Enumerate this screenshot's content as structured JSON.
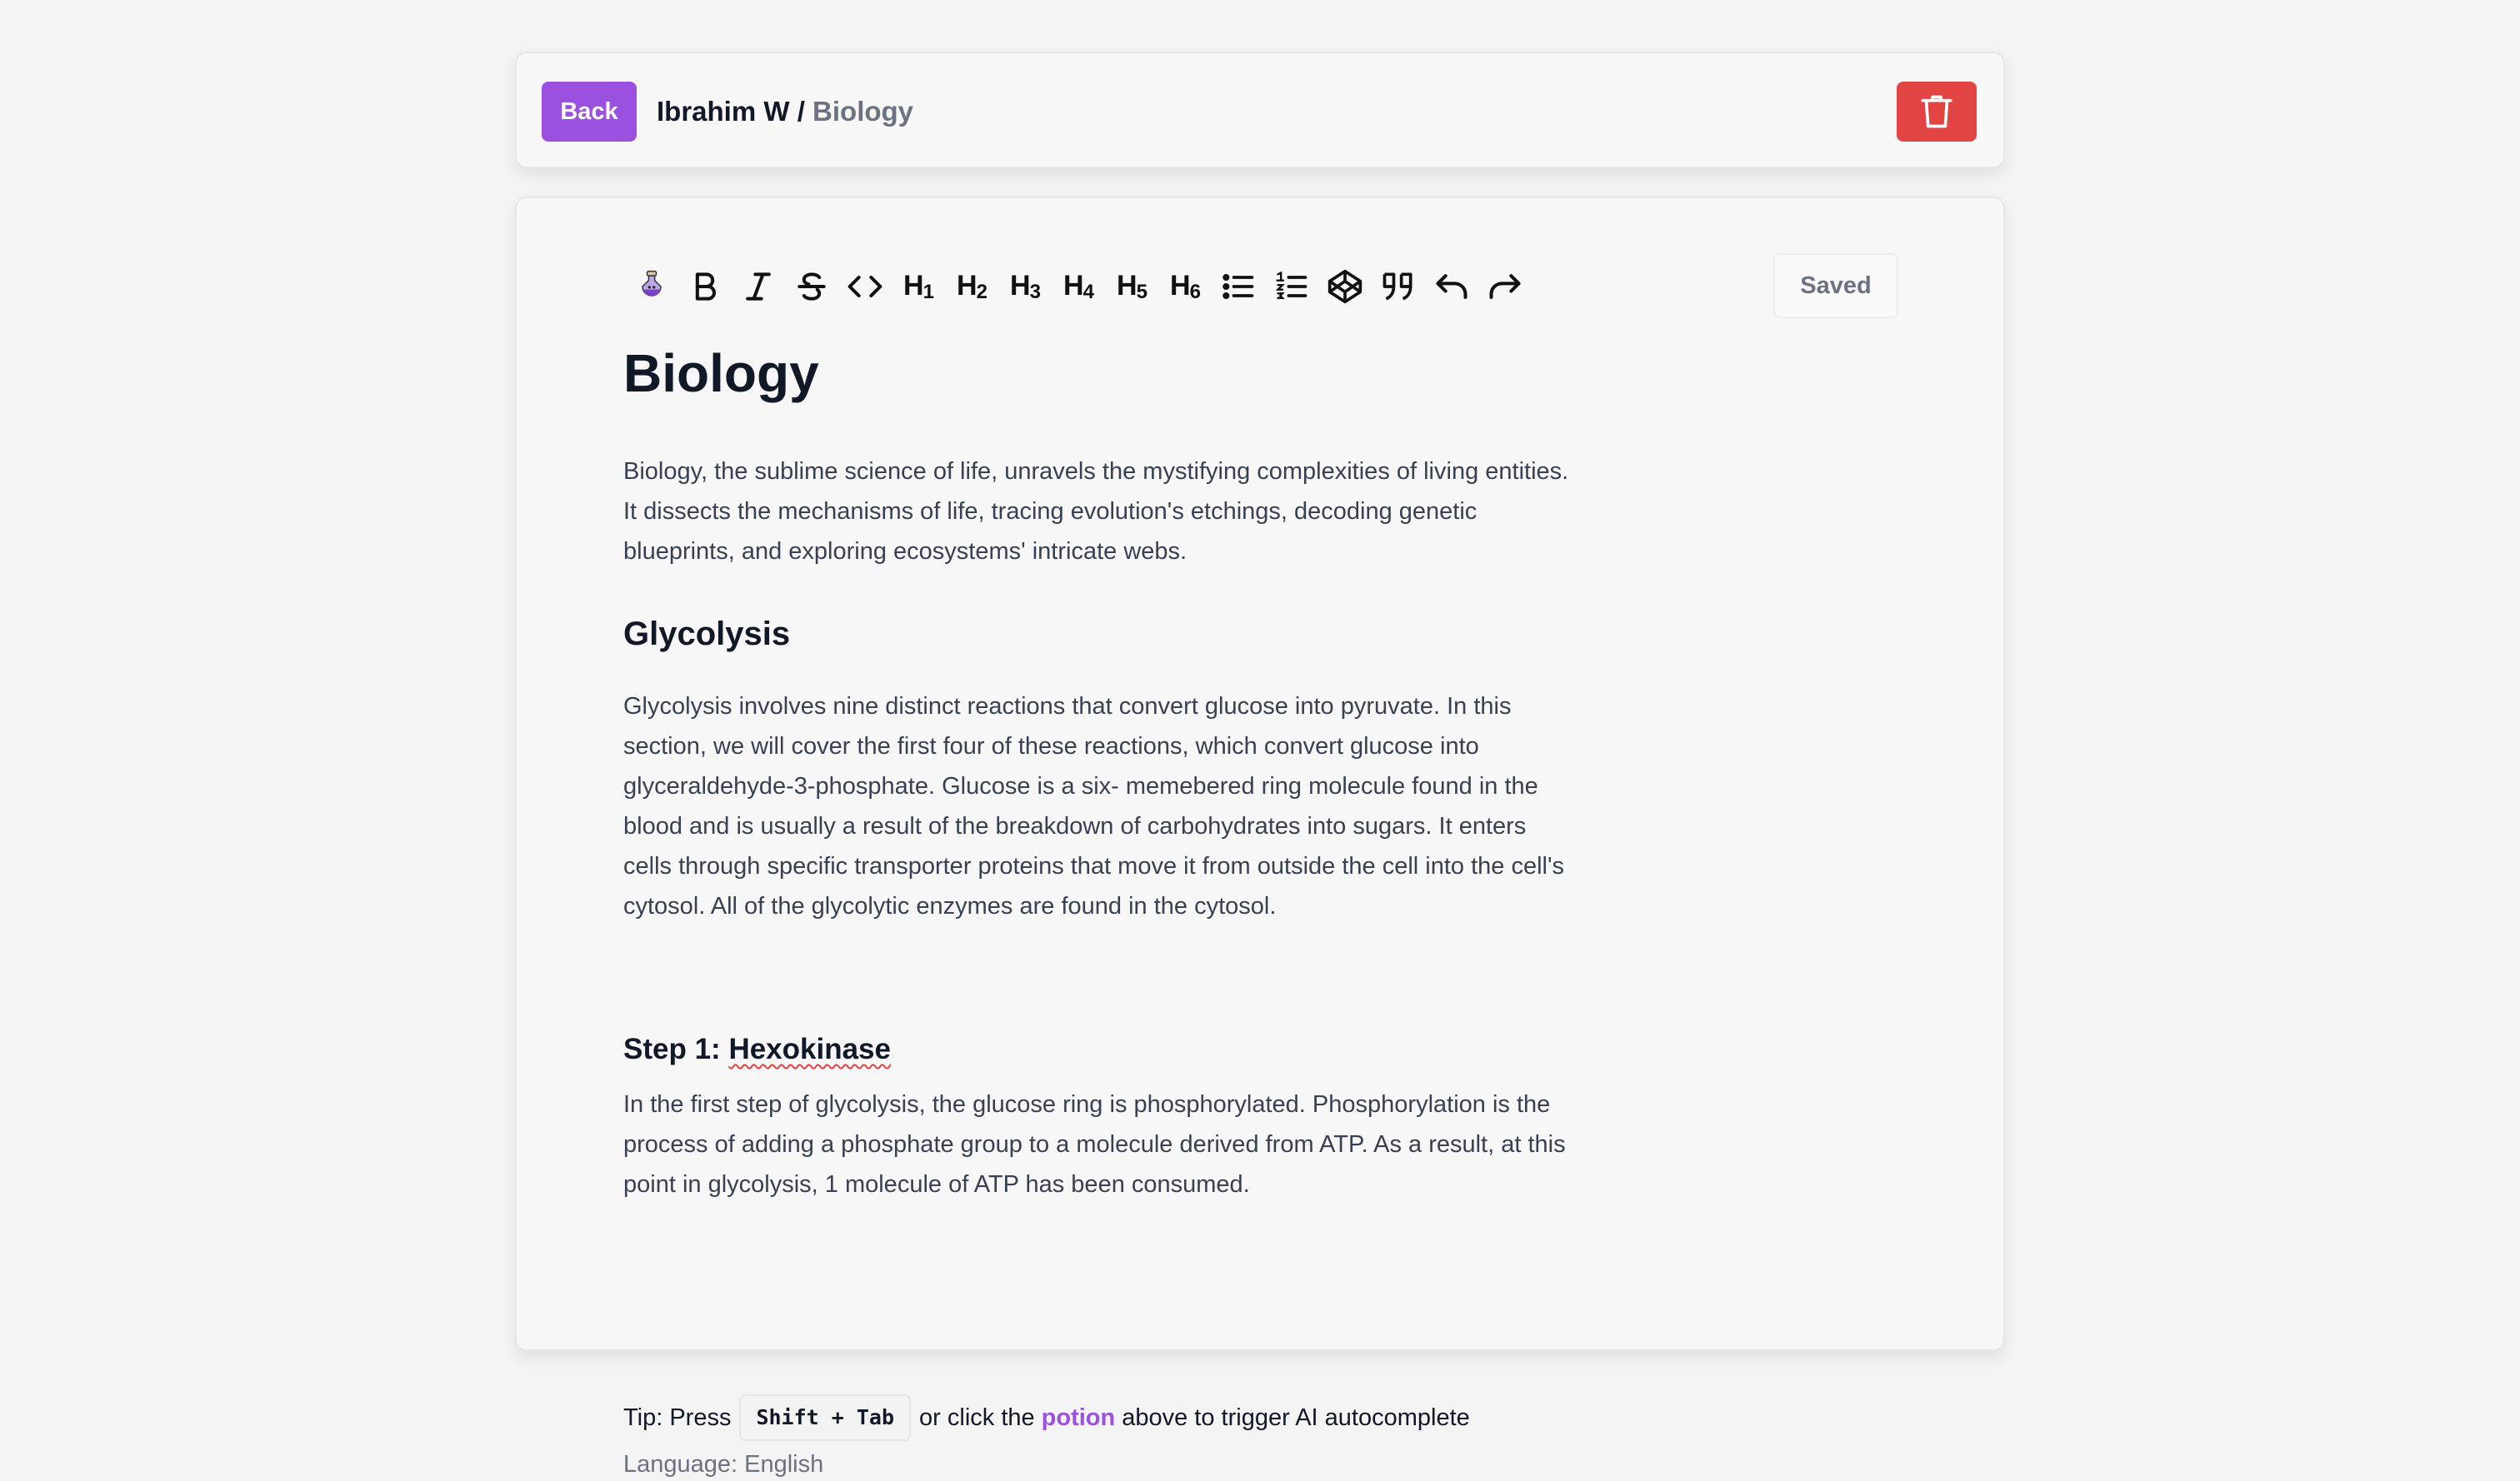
{
  "header": {
    "back_label": "Back",
    "user": "Ibrahim W",
    "separator": "/",
    "page": "Biology",
    "delete_icon": "trash-icon",
    "delete_color": "#e24444",
    "accent": "#9b51e0"
  },
  "toolbar": {
    "items": [
      {
        "name": "potion-icon"
      },
      {
        "name": "bold-icon"
      },
      {
        "name": "italic-icon"
      },
      {
        "name": "strikethrough-icon"
      },
      {
        "name": "code-icon"
      },
      {
        "name": "h1-icon",
        "label": "H",
        "num": "1"
      },
      {
        "name": "h2-icon",
        "label": "H",
        "num": "2"
      },
      {
        "name": "h3-icon",
        "label": "H",
        "num": "3"
      },
      {
        "name": "h4-icon",
        "label": "H",
        "num": "4"
      },
      {
        "name": "h5-icon",
        "label": "H",
        "num": "5"
      },
      {
        "name": "h6-icon",
        "label": "H",
        "num": "6"
      },
      {
        "name": "bullet-list-icon"
      },
      {
        "name": "ordered-list-icon"
      },
      {
        "name": "codepen-icon"
      },
      {
        "name": "quote-icon"
      },
      {
        "name": "undo-icon"
      },
      {
        "name": "redo-icon"
      }
    ],
    "saved_label": "Saved"
  },
  "document": {
    "title": "Biology",
    "intro": "Biology, the sublime science of life, unravels the mystifying complexities of living entities. It dissects the mechanisms of life, tracing evolution's etchings, decoding genetic blueprints, and exploring ecosystems' intricate webs.",
    "section_heading": "Glycolysis",
    "section_body": "Glycolysis involves nine distinct reactions that convert glucose into pyruvate. In this section, we will cover the first four of these reactions, which convert glucose into glyceraldehyde-3-phosphate. Glucose is a six- memebered ring molecule found in the blood and is usually a result of the breakdown of carbohydrates into sugars. It enters cells through specific transporter proteins that move it from outside the cell into the cell's cytosol. All of the glycolytic enzymes are found in the cytosol.",
    "step_prefix": "Step 1:",
    "step_name": "Hexokinase",
    "step_body": "In the first step of glycolysis, the glucose ring is phosphorylated. Phosphorylation is the process of adding a phosphate group to a molecule derived from ATP. As a result, at this point in glycolysis, 1 molecule of ATP has been consumed."
  },
  "tip": {
    "prefix": "Tip: Press",
    "shortcut": "Shift + Tab",
    "middle": "or click the",
    "link": "potion",
    "suffix": "above to trigger AI autocomplete"
  },
  "language": "Language: English"
}
